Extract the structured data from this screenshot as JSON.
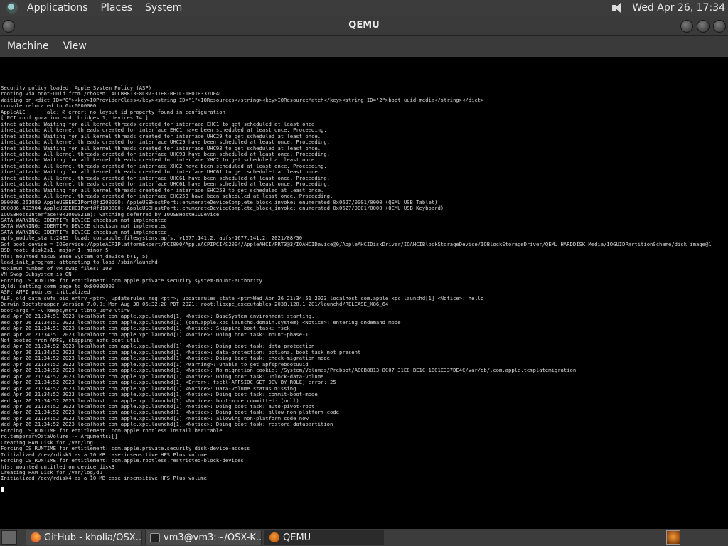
{
  "top_panel": {
    "menus": [
      "Applications",
      "Places",
      "System"
    ],
    "clock": "Wed Apr 26, 17:34"
  },
  "window": {
    "title": "QEMU",
    "menu": [
      "Machine",
      "View"
    ]
  },
  "console_lines": [
    "Security policy loaded: Apple System Policy (ASP)",
    "rooting via boot-uuid from /chosen: ACCB8813-8C07-31E8-BE1C-1B01E337DE4C",
    "Waiting on <dict ID=\"0\"><key>IOProviderClass</key><string ID=\"1\">IOResources</string><key>IOResourceMatch</key><string ID=\"2\">boot-uuid-media</string></dict>",
    "console relocated to 0xc0000000",
    "AppleALC       alc: @ error: no layout-id property found in configuration",
    "[ PCI configuration end, bridges 1, devices 14 ]",
    "ifnet_attach: Waiting for all kernel threads created for interface EHC1 to get scheduled at least once.",
    "ifnet_attach: All kernel threads created for interface EHC1 have been scheduled at least once. Proceeding.",
    "ifnet_attach: Waiting for all kernel threads created for interface UHC29 to get scheduled at least once.",
    "ifnet_attach: All kernel threads created for interface UHC29 have been scheduled at least once. Proceeding.",
    "ifnet_attach: Waiting for all kernel threads created for interface UHC93 to get scheduled at least once.",
    "ifnet_attach: All kernel threads created for interface UHC93 have been scheduled at least once. Proceeding.",
    "ifnet_attach: Waiting for all kernel threads created for interface XHC2 to get scheduled at least once.",
    "ifnet_attach: All kernel threads created for interface XHC2 have been scheduled at least once. Proceeding.",
    "ifnet_attach: Waiting for all kernel threads created for interface UHC61 to get scheduled at least once.",
    "ifnet_attach: All kernel threads created for interface UHC61 have been scheduled at least once. Proceeding.",
    "ifnet_attach: All kernel threads created for interface UHC61 have been scheduled at least once. Proceeding.",
    "ifnet_attach: Waiting for all kernel threads created for interface EHC253 to get scheduled at least once.",
    "ifnet_attach: All kernel threads created for interface EHC253 have been scheduled at least once. Proceeding.",
    "000006.261080 AppleUSBEHCIPort@fd200000: AppleUSBHostPort::enumerateDeviceComplete_block_invoke: enumerated 0x0627/0001/0000 (QEMU USB Tablet)",
    "000006.403904 AppleUSBEHCIPort@fd100000: AppleUSBHostPort::enumerateDeviceComplete_block_invoke: enumerated 0x0627/0001/0000 (QEMU USB Keyboard)",
    "IOUSBHostInterface(0x1000021e): watching deferred by IOUSBHostHIDDevice",
    "SATA WARNING: IDENTIFY DEVICE checksum not implemented",
    "SATA WARNING: IDENTIFY DEVICE checksum not implemented",
    "SATA WARNING: IDENTIFY DEVICE checksum not implemented",
    "apfs_module_start:2485: load: com.apple.filesystems.apfs, v1677.141.2, apfs-1677.141.2, 2021/08/30",
    "Got boot device = IOService:/AppleACPIPlatformExpert/PCI000/AppleACPIPCI/S2004/AppleAHCI/PRT3@3/IOAHCIDevice@0/AppleAHCIDiskDriver/IOAHCIBlockStorageDevice/IOBlockStorageDriver/QEMU HARDDISK Media/IOGUIDPartitionScheme/disk image@1",
    "BSD root: disk2s1, major 1, minor 5",
    "hfs: mounted macOS Base System on device b(1, 5)",
    "load_init_program: attempting to load /sbin/launchd",
    "Maximum number of VM swap files: 100",
    "VM Swap Subsystem is ON",
    "Forcing CS_RUNTIME for entitlement: com.apple.private.security.system-mount-authority",
    "dyld: setting comm page to 0x80000000",
    "ASP: AMFI pointer initialized",
    "ALF, old data swfs_pid_entry <ptr>, updaterules_msg <ptr>, updaterules_state <ptr>Wed Apr 26 21:34:51 2023 localhost com.apple.xpc.launchd[1] <Notice>: hello",
    "Darwin Bootstrapper Version 7.0.0: Mon Aug 30 06:32:20 PDT 2021; root:libxpc_executables-2038.120.1~201/launchd/RELEASE_X86_64",
    "boot-args = -v keepsyms=1 tlbto_us=0 vti=9",
    "Wed Apr 26 21:34:51 2023 localhost com.apple.xpc.launchd[1] <Notice>: BaseSystem environment starting.",
    "Wed Apr 26 21:34:51 2023 localhost com.apple.xpc.launchd[1] (com.apple.xpc.launchd.domain.system) <Notice>: entering ondemand mode",
    "Wed Apr 26 21:34:51 2023 localhost com.apple.xpc.launchd[1] <Notice>: Skipping boot-task: fsck",
    "Wed Apr 26 21:34:51 2023 localhost com.apple.xpc.launchd[1] <Notice>: Doing boot task: mount-phase-1",
    "Not booted from APFS, skipping apfs_boot_util",
    "Wed Apr 26 21:34:52 2023 localhost com.apple.xpc.launchd[1] <Notice>: Doing boot task: data-protection",
    "Wed Apr 26 21:34:52 2023 localhost com.apple.xpc.launchd[1] <Notice>: data-protection: optional boot task not present",
    "Wed Apr 26 21:34:52 2023 localhost com.apple.xpc.launchd[1] <Notice>: Doing boot task: check-migration-mode",
    "Wed Apr 26 21:34:52 2023 localhost com.apple.xpc.launchd[1] <Warning>: Unable to get apfsprebootuuid",
    "Wed Apr 26 21:34:52 2023 localhost com.apple.xpc.launchd[1] <Notice>: No migration cookie: /System/Volumes/Preboot/ACCB8813-8C07-31E8-BE1C-1B01E337DE4C/var/db/.com.apple.templatemigration",
    "Wed Apr 26 21:34:52 2023 localhost com.apple.xpc.launchd[1] <Notice>: Doing boot task: unlock-data-volume",
    "Wed Apr 26 21:34:52 2023 localhost com.apple.xpc.launchd[1] <Error>: fsctl(APFSIOC_GET_DEV_BY_ROLE) error: 25",
    "Wed Apr 26 21:34:52 2023 localhost com.apple.xpc.launchd[1] <Notice>: Data-volume status missing",
    "Wed Apr 26 21:34:52 2023 localhost com.apple.xpc.launchd[1] <Notice>: Doing boot task: commit-boot-mode",
    "Wed Apr 26 21:34:52 2023 localhost com.apple.xpc.launchd[1] <Notice>: boot-mode committed: (null)",
    "Wed Apr 26 21:34:52 2023 localhost com.apple.xpc.launchd[1] <Notice>: Doing boot task: auto-pivot-root",
    "Wed Apr 26 21:34:52 2023 localhost com.apple.xpc.launchd[1] <Notice>: Doing boot task: allow-non-platform-code",
    "Wed Apr 26 21:34:52 2023 localhost com.apple.xpc.launchd[1] <Notice>: allowing non-platform code now",
    "Wed Apr 26 21:34:52 2023 localhost com.apple.xpc.launchd[1] <Notice>: Doing boot task: restore-datapartition",
    "Forcing CS_RUNTIME for entitlement: com.apple.rootless.install.heritable",
    "rc.temporaryDataVolume -- Arguments:[]",
    "Creating RAM Disk for /var/log",
    "Forcing CS_RUNTIME for entitlement: com.apple.private.security.disk-device-access",
    "Initialized /dev/rdisk3 as a 10 MB case-insensitive HFS Plus volume",
    "Forcing CS_RUNTIME for entitlement: com.apple.rootless.restricted-block-devices",
    "hfs: mounted untitled on device disk3",
    "Creating RAM Disk for /var/log/du",
    "Initialized /dev/rdisk4 as a 10 MB case-insensitive HFS Plus volume"
  ],
  "taskbar": {
    "tasks": [
      {
        "label": "GitHub - kholia/OSX...",
        "icon": "firefox-icon"
      },
      {
        "label": "vm3@vm3:~/OSX-K...",
        "icon": "terminal-icon"
      },
      {
        "label": "QEMU",
        "icon": "qemu-icon"
      }
    ]
  }
}
